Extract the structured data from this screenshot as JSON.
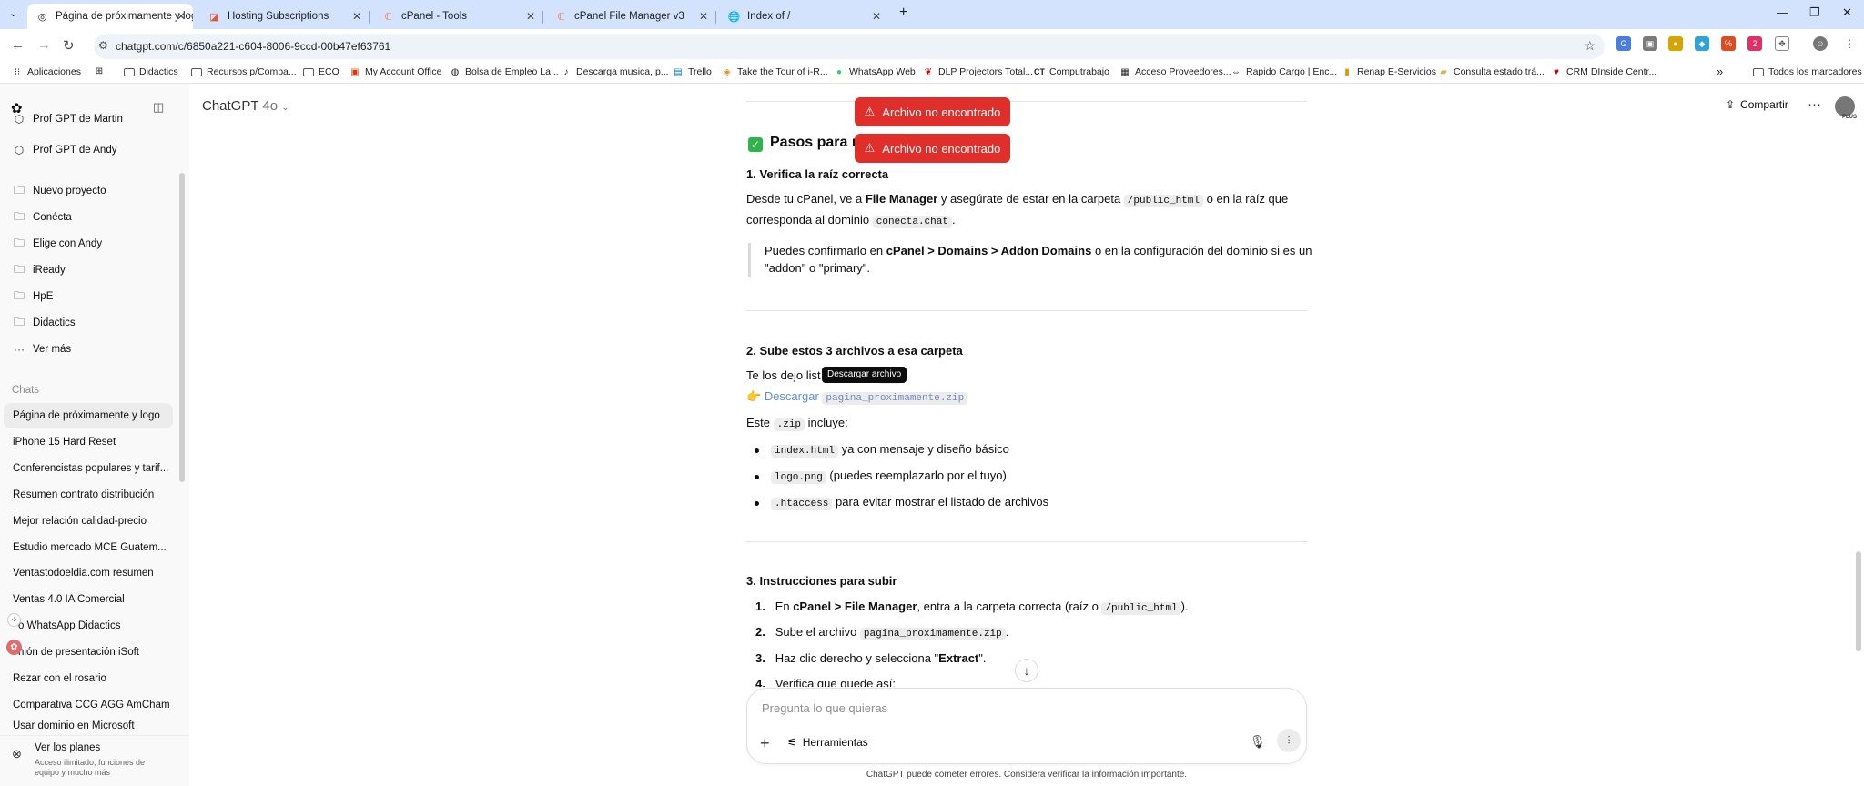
{
  "browser": {
    "tabs": [
      {
        "label": "Página de próximamente y logo",
        "active": true
      },
      {
        "label": "Hosting Subscriptions"
      },
      {
        "label": "cPanel - Tools"
      },
      {
        "label": "cPanel File Manager v3"
      },
      {
        "label": "Index of /"
      }
    ],
    "new_tab": "+",
    "url": "chatgpt.com/c/6850a221-c604-8006-9ccd-00b47ef63761",
    "bookmarks": [
      "Aplicaciones",
      "Didactics",
      "Recursos p/Compa...",
      "ECO",
      "My Account Office",
      "Bolsa de Empleo La...",
      "Descarga musica, p...",
      "Trello",
      "Take the Tour of i-R...",
      "WhatsApp Web",
      "DLP Projectors Total...",
      "Computrabajo",
      "Acceso Proveedores...",
      "Rapido Cargo | Enc...",
      "Renap E-Servicios",
      "Consulta estado trá...",
      "CRM DInside Centr..."
    ],
    "all_bookmarks": "Todos los marcadores"
  },
  "sidebar": {
    "gpts": [
      "Prof GPT de Martin",
      "Prof GPT de Andy"
    ],
    "projects": [
      "Nuevo proyecto",
      "Conécta",
      "Elige con Andy",
      "iReady",
      "HpE",
      "Didactics"
    ],
    "see_more": "Ver más",
    "chats_heading": "Chats",
    "chats": [
      "Página de próximamente y logo",
      "iPhone 15 Hard Reset",
      "Conferencistas populares y tarif...",
      "Resumen contrato distribución",
      "Mejor relación calidad-precio",
      "Estudio mercado MCE Guatem...",
      "Ventastodoeldia.com resumen",
      "Ventas 4.0 IA Comercial",
      "o WhatsApp Didactics",
      "nión de presentación iSoft",
      "Rezar con el rosario",
      "Comparativa CCG AGG AmCham",
      "Usar dominio en Microsoft"
    ],
    "plans_title": "Ver los planes",
    "plans_sub": "Acceso ilimitado, funciones de equipo y mucho más"
  },
  "header": {
    "model": "ChatGPT",
    "version": "4o",
    "share": "Compartir",
    "plus": "PLUS"
  },
  "toasts": [
    "Archivo no encontrado",
    "Archivo no encontrado"
  ],
  "tooltip": "Descargar archivo",
  "msg": {
    "pasos": "Pasos para re",
    "s1_num": "1.",
    "s1_title": "Verifica la raíz correcta",
    "s1_a": "Desde tu cPanel, ve a ",
    "s1_b": "File Manager",
    "s1_c": " y asegúrate de estar en la carpeta ",
    "s1_code1": "/public_html",
    "s1_d": " o en la raíz que",
    "s1_e": "corresponda al dominio ",
    "s1_code2": "conecta.chat",
    "s1_f": ".",
    "quote_a": "Puedes confirmarlo en ",
    "quote_b": "cPanel > Domains > Addon Domains",
    "quote_c": " o en la configuración del dominio si es un",
    "quote_d": "\"addon\" o \"primary\".",
    "s2_num": "2.",
    "s2_title": "Sube estos 3 archivos a esa carpeta",
    "s2_a": "Te los dejo list",
    "s2_code_tail": "zip",
    "dl_emoji": "👉",
    "dl_link": "Descargar",
    "dl_code": "pagina_proximamente.zip",
    "includes_a": "Este ",
    "includes_code": ".zip",
    "includes_b": " incluye:",
    "li1_code": "index.html",
    "li1_text": " ya con mensaje y diseño básico",
    "li2_code": "logo.png",
    "li2_text": " (puedes reemplazarlo por el tuyo)",
    "li3_code": ".htaccess",
    "li3_text": " para evitar mostrar el listado de archivos",
    "s3_num": "3.",
    "s3_title": "Instrucciones para subir",
    "o1_a": "En ",
    "o1_b": "cPanel > File Manager",
    "o1_c": ", entra a la carpeta correcta (raíz o ",
    "o1_code": "/public_html",
    "o1_d": ").",
    "o2_a": "Sube el archivo ",
    "o2_code": "pagina_proximamente.zip",
    "o2_b": ".",
    "o3_a": "Haz clic derecho y selecciona \"",
    "o3_b": "Extract",
    "o3_c": "\".",
    "o4": "Verifica que quede así:"
  },
  "composer": {
    "placeholder": "Pregunta lo que quieras",
    "tools": "Herramientas"
  },
  "footer": "ChatGPT puede cometer errores. Considera verificar la información importante."
}
